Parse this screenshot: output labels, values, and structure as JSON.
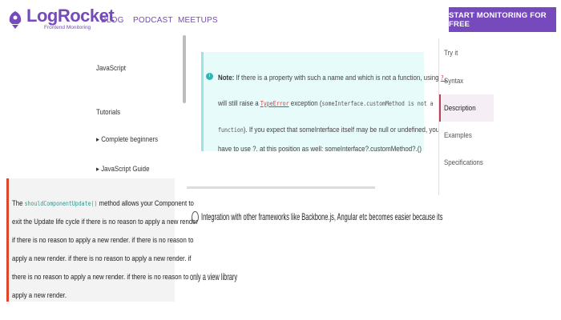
{
  "brand": {
    "name": "LogRocket",
    "tagline": "Frontend Monitoring",
    "accent": "#764abc"
  },
  "nav": {
    "links": [
      "BLOG",
      "PODCAST",
      "MEETUPS"
    ],
    "cta": "START MONITORING FOR FREE"
  },
  "sidebar": {
    "items": [
      "JavaScript",
      "Tutorials",
      "Complete beginners",
      "JavaScript Guide"
    ]
  },
  "note": {
    "label": "Note:",
    "line1_text": "If there is a property with such a name and which is not a function, using",
    "line1_code": "?.",
    "line2_pre": "will still raise a",
    "line2_link": "TypeError",
    "line2_mid": "exception (",
    "line2_code": "someInterface.customMethod is not a",
    "line3_code": "function",
    "line3_text": "). If you expect that someInterface itself may be null or undefined, you",
    "line4_text": "have to use ?. at this position as well: someInterface?.customMethod?.()"
  },
  "toc": {
    "items": [
      "Try it",
      "Syntax",
      "Description",
      "Examples",
      "Specifications"
    ],
    "active": "Description"
  },
  "scu": {
    "line1_pre": "The",
    "line1_code": "shouldComponentUpdate()",
    "line1_post": "method allows your Component to",
    "line2": "exit the Update life cycle if there is no reason to apply a new render",
    "line3": "if there is no reason to apply a new render. if there is no reason to",
    "line4": "apply a new render. if there is no reason to apply a new render. if",
    "line5": "there is no reason to apply a new render. if there is no reason to",
    "line6": "apply a new render."
  },
  "integration": {
    "line1": "Integration with other frameworks like Backbone.js, Angular etc becomes easier because its",
    "line2": "only a view library"
  }
}
